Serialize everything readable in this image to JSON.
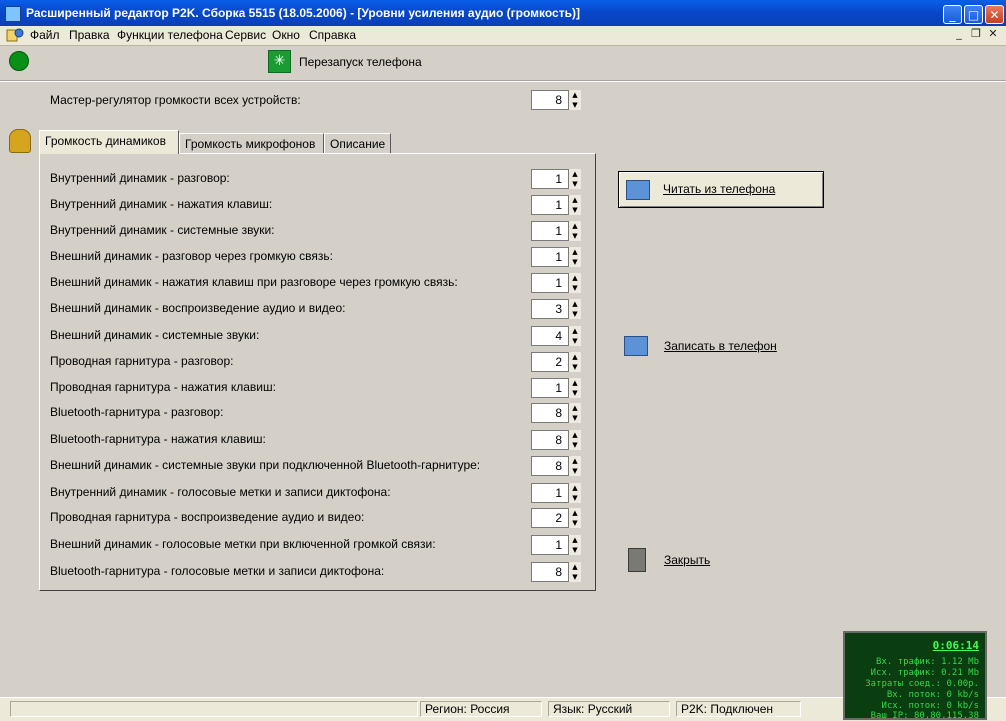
{
  "window": {
    "title": "Расширенный редактор P2K. Сборка 5515 (18.05.2006) - [Уровни усиления аудио (громкость)]"
  },
  "menu": [
    "Файл",
    "Правка",
    "Функции телефона",
    "Сервис",
    "Окно",
    "Справка"
  ],
  "toolbar": {
    "restart_label": "Перезапуск телефона"
  },
  "master": {
    "label": "Мастер-регулятор громкости всех устройств:",
    "value": "8"
  },
  "tabs": [
    {
      "label": "Громкость динамиков",
      "active": true
    },
    {
      "label": "Громкость микрофонов",
      "active": false
    },
    {
      "label": "Описание",
      "active": false
    }
  ],
  "settings": [
    {
      "label": "Внутренний динамик - разговор:",
      "value": "1"
    },
    {
      "label": "Внутренний динамик - нажатия клавиш:",
      "value": "1"
    },
    {
      "label": "Внутренний динамик - системные звуки:",
      "value": "1"
    },
    {
      "label": "Внешний динамик - разговор через громкую связь:",
      "value": "1"
    },
    {
      "label": "Внешний динамик - нажатия клавиш при разговоре через громкую связь:",
      "value": "1"
    },
    {
      "label": "Внешний динамик - воспроизведение аудио и видео:",
      "value": "3"
    },
    {
      "label": "Внешний динамик - системные звуки:",
      "value": "4"
    },
    {
      "label": "Проводная гарнитура - разговор:",
      "value": "2"
    },
    {
      "label": "Проводная гарнитура - нажатия клавиш:",
      "value": "1"
    },
    {
      "label": "Bluetooth-гарнитура - разговор:",
      "value": "8"
    },
    {
      "label": "Bluetooth-гарнитура - нажатия клавиш:",
      "value": "8"
    },
    {
      "label": "Внешний динамик - системные звуки при подключенной Bluetooth-гарнитуре:",
      "value": "8"
    },
    {
      "label": "Внутренний динамик - голосовые метки и записи диктофона:",
      "value": "1"
    },
    {
      "label": "Проводная гарнитура - воспроизведение аудио и видео:",
      "value": "2"
    },
    {
      "label": "Внешний динамик - голосовые метки при включенной громкой связи:",
      "value": "1"
    },
    {
      "label": "Bluetooth-гарнитура - голосовые метки и записи диктофона:",
      "value": "8"
    }
  ],
  "actions": {
    "read": "Читать из телефона",
    "write": "Записать в телефон",
    "close": "Закрыть"
  },
  "statusbar": {
    "region": "Регион: Россия",
    "language": "Язык: Русский",
    "connection": "P2K: Подключен"
  },
  "traffic": {
    "timer": "0:06:14",
    "rows": [
      "Вх. трафик: 1.12 Mb",
      "Исх. трафик: 0.21 Mb",
      "Затраты соед.: 0.00р.",
      "Вх. поток: 0 kb/s",
      "Исх. поток: 0 kb/s",
      "Ваш IP: 80.80.115.38"
    ]
  },
  "colors": {
    "titlebar": "#0747c9",
    "face": "#d4d0c8",
    "monitor_bg": "#0a3d10",
    "monitor_text": "#34d84a",
    "led": "#0a8f17"
  }
}
